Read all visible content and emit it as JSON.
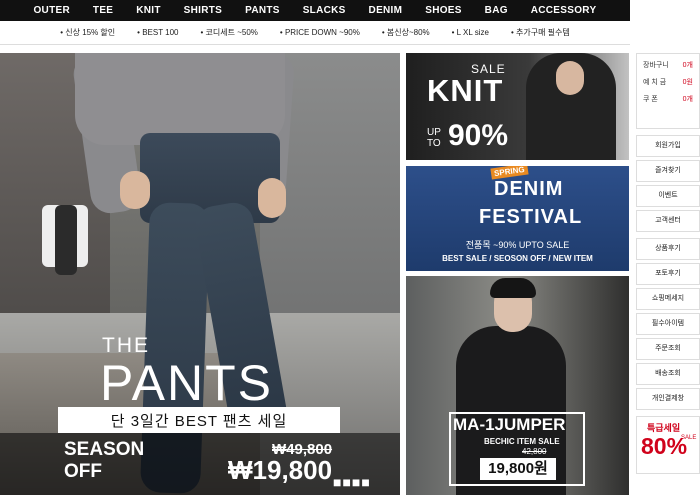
{
  "top_nav": [
    "OUTER",
    "TEE",
    "KNIT",
    "SHIRTS",
    "PANTS",
    "SLACKS",
    "DENIM",
    "SHOES",
    "BAG",
    "ACCESSORY"
  ],
  "sub_nav": [
    {
      "label": "신상 15% 할인",
      "highlight": false
    },
    {
      "label": "BEST 100",
      "highlight": false
    },
    {
      "label": "코디세트 ~50%",
      "highlight": false
    },
    {
      "label": "PRICE DOWN ~90%",
      "highlight": false
    },
    {
      "label": "봄신상~80%",
      "highlight": false
    },
    {
      "label": "L XL size",
      "highlight": false
    },
    {
      "label": "추가구매 필수템",
      "highlight": false
    }
  ],
  "hero": {
    "title_small": "THE",
    "title_big": "PANTS",
    "sale_text": "단 3일간 BEST 팬츠 세일",
    "season_text_1": "SEASON",
    "season_text_2": "OFF",
    "original_price": "₩49,800",
    "sale_price": "₩19,800"
  },
  "knit_banner": {
    "sale": "SALE",
    "title": "KNIT",
    "up": "UP",
    "to": "TO",
    "percent": "90%"
  },
  "denim_banner": {
    "badge": "SPRING",
    "title_1": "DENIM",
    "title_2": "FESTIVAL",
    "line_1": "전품목 ~90% UPTO SALE",
    "line_2": "BEST SALE / SEOSON OFF / NEW ITEM"
  },
  "jumper_banner": {
    "title": "MA-1JUMPER",
    "subtitle": "BECHIC ITEM SALE",
    "original_price": "42,800",
    "price": "19,800원"
  },
  "sidebar": {
    "cart": [
      {
        "label": "장바구니",
        "value": "0개"
      },
      {
        "label": "예 치 금",
        "value": "0원"
      },
      {
        "label": "쿠 폰",
        "value": "0개"
      }
    ],
    "menu_1": [
      "회원가입",
      "즐겨찾기",
      "이벤트",
      "고객센터"
    ],
    "menu_2": [
      "상품후기",
      "포토후기",
      "쇼핑메세지",
      "필수아이템",
      "주문조회",
      "배송조회",
      "개인결제창"
    ],
    "sale_title": "특급세일",
    "sale_percent": "80%",
    "sale_word": "SALE"
  },
  "colors": {
    "accent": "#d0021b",
    "nav_bg": "#111111",
    "denim_bg": "#2d4f8a"
  }
}
